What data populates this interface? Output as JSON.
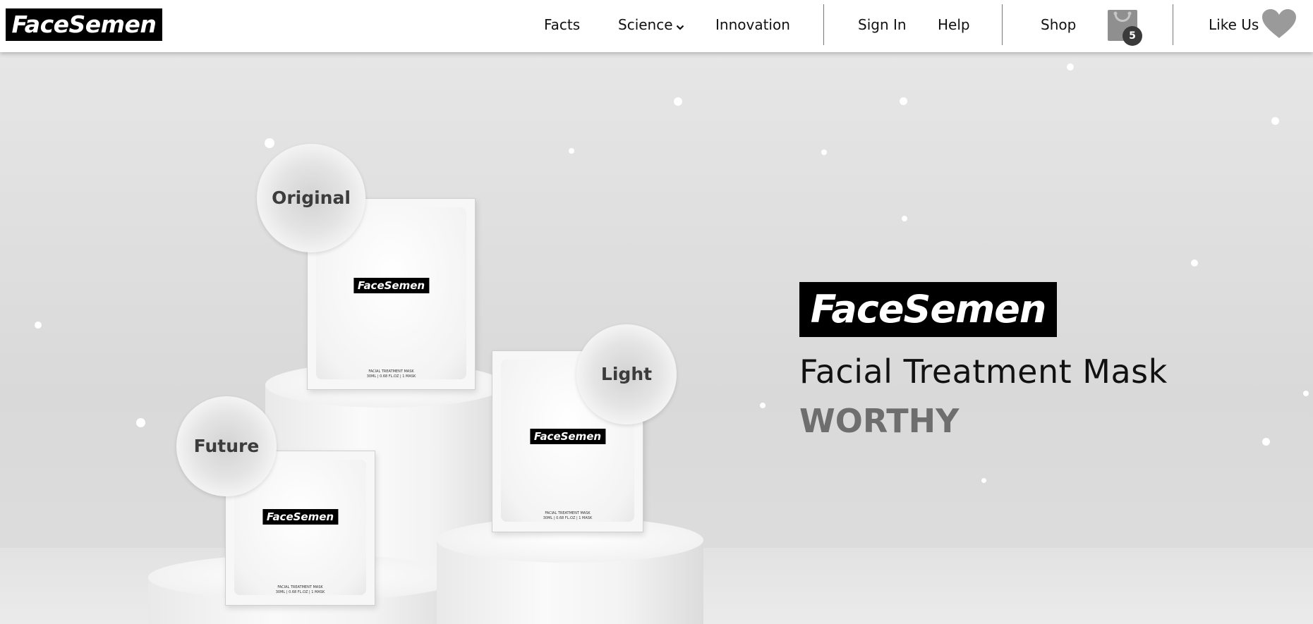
{
  "nav": {
    "logo": "FaceSemen",
    "links": {
      "facts": "Facts",
      "science": "Science",
      "innovation": "Innovation",
      "sign_in": "Sign In",
      "help": "Help",
      "shop": "Shop",
      "like_us": "Like Us"
    },
    "cart_count": "5",
    "icons": {
      "science_dropdown": "chevron-down-icon",
      "cart": "shopping-bag-icon",
      "like": "heart-icon"
    }
  },
  "hero": {
    "brand": "FaceSemen",
    "headline": "Facial Treatment Mask",
    "subhead": "WORTHY",
    "products": [
      {
        "label": "Original",
        "packet_logo": "FaceSemen",
        "fine_print_1": "FACIAL TREATMENT MASK",
        "fine_print_2": "30ML | 0.68 FL.OZ | 1 MASK"
      },
      {
        "label": "Light",
        "packet_logo": "FaceSemen",
        "fine_print_1": "FACIAL TREATMENT MASK",
        "fine_print_2": "30ML | 0.68 FL.OZ | 1 MASK"
      },
      {
        "label": "Future",
        "packet_logo": "FaceSemen",
        "fine_print_1": "FACIAL TREATMENT MASK",
        "fine_print_2": "30ML | 0.68 FL.OZ | 1 MASK"
      }
    ]
  },
  "colors": {
    "nav_bg": "#ffffff",
    "hero_bg": "#dddddd",
    "brand_black": "#000000",
    "subhead_gray": "#6e6e6e"
  }
}
